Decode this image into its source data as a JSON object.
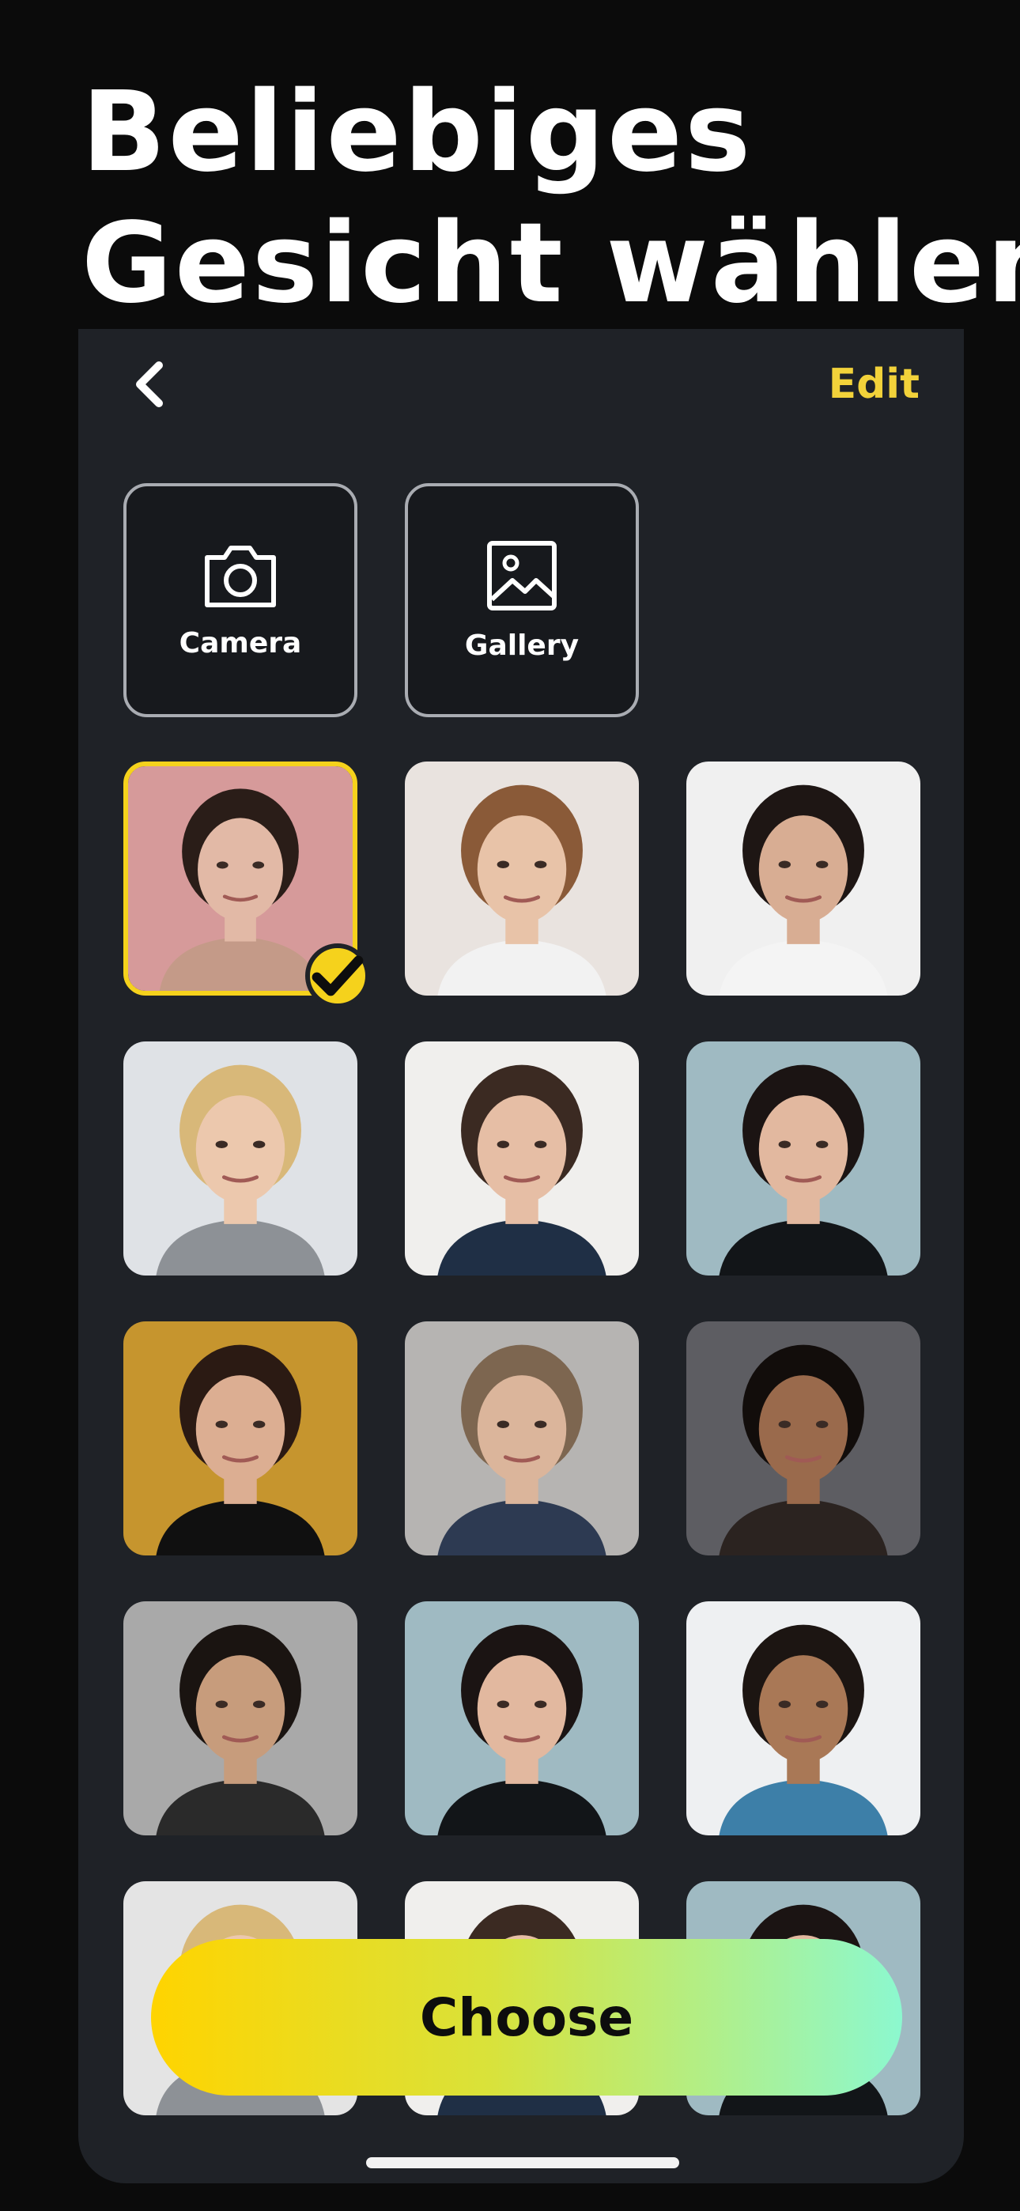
{
  "headline": {
    "line1": "Beliebiges",
    "line2": "Gesicht wählen"
  },
  "nav": {
    "back_icon": "chevron-left-icon",
    "edit_label": "Edit"
  },
  "sources": [
    {
      "label": "Camera",
      "icon": "camera-icon"
    },
    {
      "label": "Gallery",
      "icon": "image-icon"
    }
  ],
  "faces": [
    {
      "bg": "#d69a9a",
      "skin": "#e2b9a6",
      "hair": "#2a1d18",
      "shirt": "#c49a88",
      "selected": true
    },
    {
      "bg": "#e9e3df",
      "skin": "#e8c3a8",
      "hair": "#8a5a38",
      "shirt": "#f2f2f2",
      "selected": false
    },
    {
      "bg": "#f0f0f0",
      "skin": "#d8ad93",
      "hair": "#1e1614",
      "shirt": "#f4f4f4",
      "selected": false
    },
    {
      "bg": "#dfe2e6",
      "skin": "#ecc8ad",
      "hair": "#d8b879",
      "shirt": "#8d9196",
      "selected": false
    },
    {
      "bg": "#f0efed",
      "skin": "#e6bea5",
      "hair": "#3b2a22",
      "shirt": "#1f2f45",
      "selected": false
    },
    {
      "bg": "#9fbac2",
      "skin": "#e2b89f",
      "hair": "#1b1413",
      "shirt": "#121518",
      "selected": false
    },
    {
      "bg": "#c6952e",
      "skin": "#dcae92",
      "hair": "#2b1a13",
      "shirt": "#101010",
      "selected": false
    },
    {
      "bg": "#b6b4b2",
      "skin": "#dbb59b",
      "hair": "#7d6650",
      "shirt": "#2d3a52",
      "selected": false
    },
    {
      "bg": "#5d5d62",
      "skin": "#9a6a4c",
      "hair": "#120d0b",
      "shirt": "#2b2320",
      "selected": false
    },
    {
      "bg": "#a9a9a9",
      "skin": "#c79c7c",
      "hair": "#1a1411",
      "shirt": "#2a2a2a",
      "selected": false
    },
    {
      "bg": "#9fbac2",
      "skin": "#e2b89f",
      "hair": "#1b1413",
      "shirt": "#121518",
      "selected": false
    },
    {
      "bg": "#eef0f2",
      "skin": "#a97856",
      "hair": "#1c1512",
      "shirt": "#3d7fa8",
      "selected": false
    },
    {
      "bg": "#e4e4e4",
      "skin": "#ecc8ad",
      "hair": "#d8b879",
      "shirt": "#8d9196",
      "selected": false
    },
    {
      "bg": "#f0efed",
      "skin": "#e6bea5",
      "hair": "#3b2a22",
      "shirt": "#1f2f45",
      "selected": false
    },
    {
      "bg": "#9fbac2",
      "skin": "#e2b89f",
      "hair": "#1b1413",
      "shirt": "#121518",
      "selected": false
    }
  ],
  "choose_button": {
    "label": "Choose"
  },
  "colors": {
    "accent": "#f5d21c",
    "edit": "#f2d23a",
    "panel": "#1f2227",
    "background": "#0b0b0b",
    "button_gradient_start": "#ffd400",
    "button_gradient_end": "#8cf8cf"
  }
}
